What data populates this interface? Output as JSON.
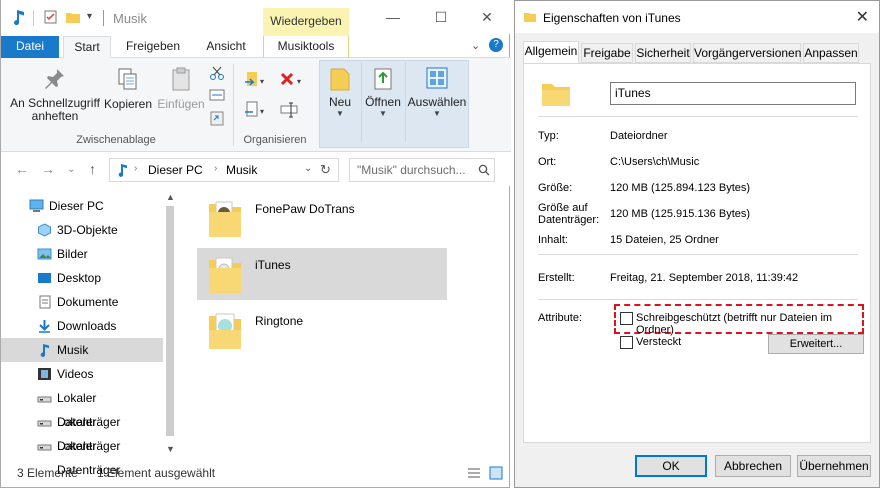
{
  "explorer": {
    "title": "Musik",
    "context_tab_header": "Wiedergeben",
    "tabs": [
      "Datei",
      "Start",
      "Freigeben",
      "Ansicht",
      "Musiktools"
    ],
    "ribbon": {
      "pin_label": "An Schnellzugriff anheften",
      "copy_label": "Kopieren",
      "paste_label": "Einfügen",
      "clipboard_group": "Zwischenablage",
      "organize_group": "Organisieren",
      "new_label": "Neu",
      "open_label": "Öffnen",
      "select_label": "Auswählen"
    },
    "address": {
      "crumbs": [
        "Dieser PC",
        "Musik"
      ],
      "search_placeholder": "\"Musik\" durchsuch..."
    },
    "nav": [
      {
        "label": "Dieser PC",
        "icon": "pc-icon"
      },
      {
        "label": "3D-Objekte",
        "icon": "3d-objects-icon"
      },
      {
        "label": "Bilder",
        "icon": "pictures-icon"
      },
      {
        "label": "Desktop",
        "icon": "desktop-icon"
      },
      {
        "label": "Dokumente",
        "icon": "documents-icon"
      },
      {
        "label": "Downloads",
        "icon": "downloads-icon"
      },
      {
        "label": "Musik",
        "icon": "music-icon"
      },
      {
        "label": "Videos",
        "icon": "videos-icon"
      },
      {
        "label": "Lokaler Datenträger",
        "icon": "drive-icon"
      },
      {
        "label": "Lokaler Datenträger",
        "icon": "drive-icon"
      },
      {
        "label": "Lokaler Datenträger",
        "icon": "drive-icon"
      }
    ],
    "files": [
      {
        "label": "FonePaw DoTrans"
      },
      {
        "label": "iTunes"
      },
      {
        "label": "Ringtone"
      }
    ],
    "status": {
      "count": "3 Elemente",
      "selection": "1 Element ausgewählt"
    }
  },
  "props": {
    "title": "Eigenschaften von iTunes",
    "tabs": [
      "Allgemein",
      "Freigabe",
      "Sicherheit",
      "Vorgängerversionen",
      "Anpassen"
    ],
    "name": "iTunes",
    "typ_label": "Typ:",
    "typ_value": "Dateiordner",
    "ort_label": "Ort:",
    "ort_value": "C:\\Users\\ch\\Music",
    "groesse_label": "Größe:",
    "groesse_value": "120 MB (125.894.123 Bytes)",
    "groesse_disk_label": "Größe auf Datenträger:",
    "groesse_disk_value": "120 MB (125.915.136 Bytes)",
    "inhalt_label": "Inhalt:",
    "inhalt_value": "15 Dateien, 25 Ordner",
    "erstellt_label": "Erstellt:",
    "erstellt_value": "Freitag, 21. September 2018, 11:39:42",
    "attribute_label": "Attribute:",
    "readonly_label": "Schreibgeschützt (betrifft nur Dateien im Ordner)",
    "hidden_label": "Versteckt",
    "advanced_button": "Erweitert...",
    "ok_button": "OK",
    "cancel_button": "Abbrechen",
    "apply_button": "Übernehmen"
  },
  "colors": {
    "accent": "#1979ca",
    "context_tab": "#fbf3b2",
    "selection": "#d9d9d9",
    "highlight": "#e0101e",
    "folder": "#f5cd55"
  }
}
